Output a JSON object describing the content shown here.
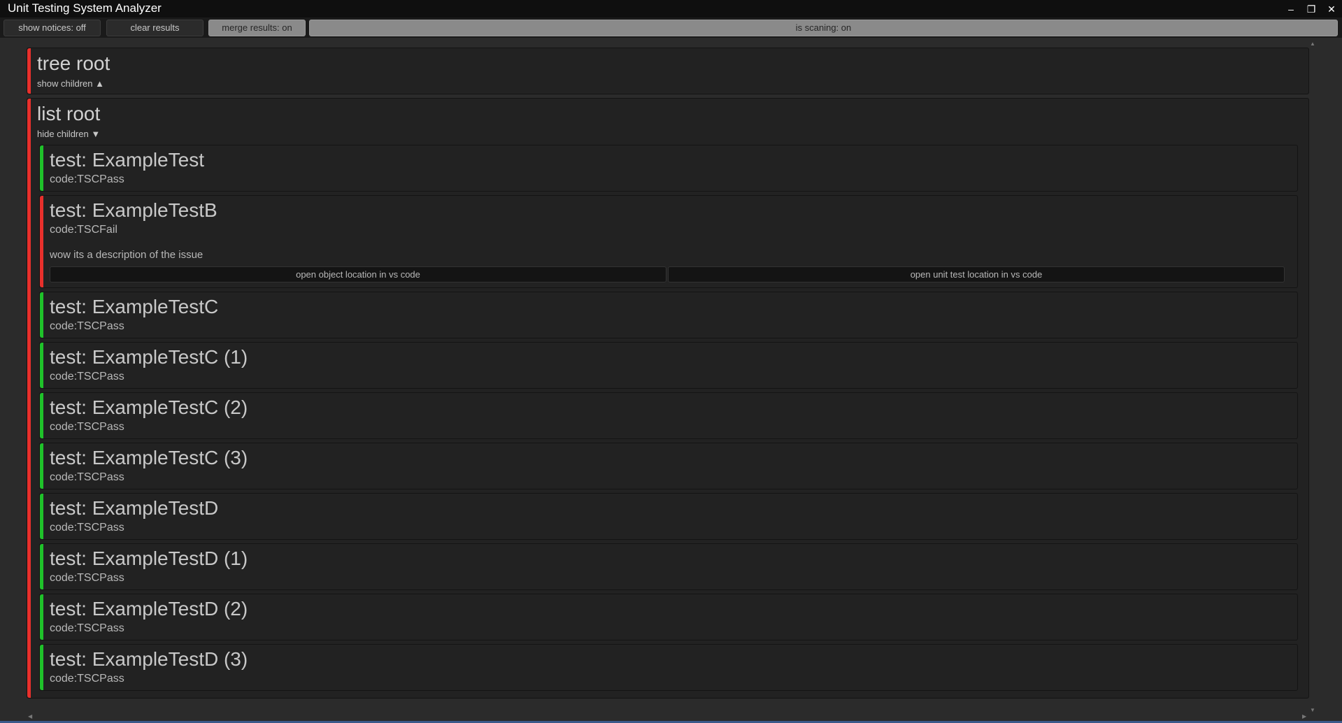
{
  "window": {
    "title": "Unit Testing System Analyzer",
    "minimize": "–",
    "maximize": "❐",
    "close": "✕"
  },
  "toolbar": {
    "show_notices": "show notices: off",
    "clear_results": "clear results",
    "merge_results": "merge results: on",
    "is_scanning": "is scaning: on"
  },
  "tree_root": {
    "title": "tree root",
    "toggle": "show children ▲",
    "status_color": "#e8302c"
  },
  "list_root": {
    "title": "list root",
    "toggle": "hide children ▼",
    "status_color": "#e8302c",
    "tests": [
      {
        "title": "test: ExampleTest",
        "code": "code:TSCPass",
        "status": "pass"
      },
      {
        "title": "test: ExampleTestB",
        "code": "code:TSCFail",
        "status": "fail",
        "description": "wow its a description of the issue",
        "open_object": "open object location in vs code",
        "open_test": "open unit test location in vs code"
      },
      {
        "title": "test: ExampleTestC",
        "code": "code:TSCPass",
        "status": "pass"
      },
      {
        "title": "test: ExampleTestC (1)",
        "code": "code:TSCPass",
        "status": "pass"
      },
      {
        "title": "test: ExampleTestC (2)",
        "code": "code:TSCPass",
        "status": "pass"
      },
      {
        "title": "test: ExampleTestC (3)",
        "code": "code:TSCPass",
        "status": "pass"
      },
      {
        "title": "test: ExampleTestD",
        "code": "code:TSCPass",
        "status": "pass"
      },
      {
        "title": "test: ExampleTestD (1)",
        "code": "code:TSCPass",
        "status": "pass"
      },
      {
        "title": "test: ExampleTestD (2)",
        "code": "code:TSCPass",
        "status": "pass"
      },
      {
        "title": "test: ExampleTestD (3)",
        "code": "code:TSCPass",
        "status": "pass"
      }
    ]
  },
  "colors": {
    "pass": "#1fc22a",
    "fail": "#e8302c",
    "accent": "#3b5a8a"
  }
}
